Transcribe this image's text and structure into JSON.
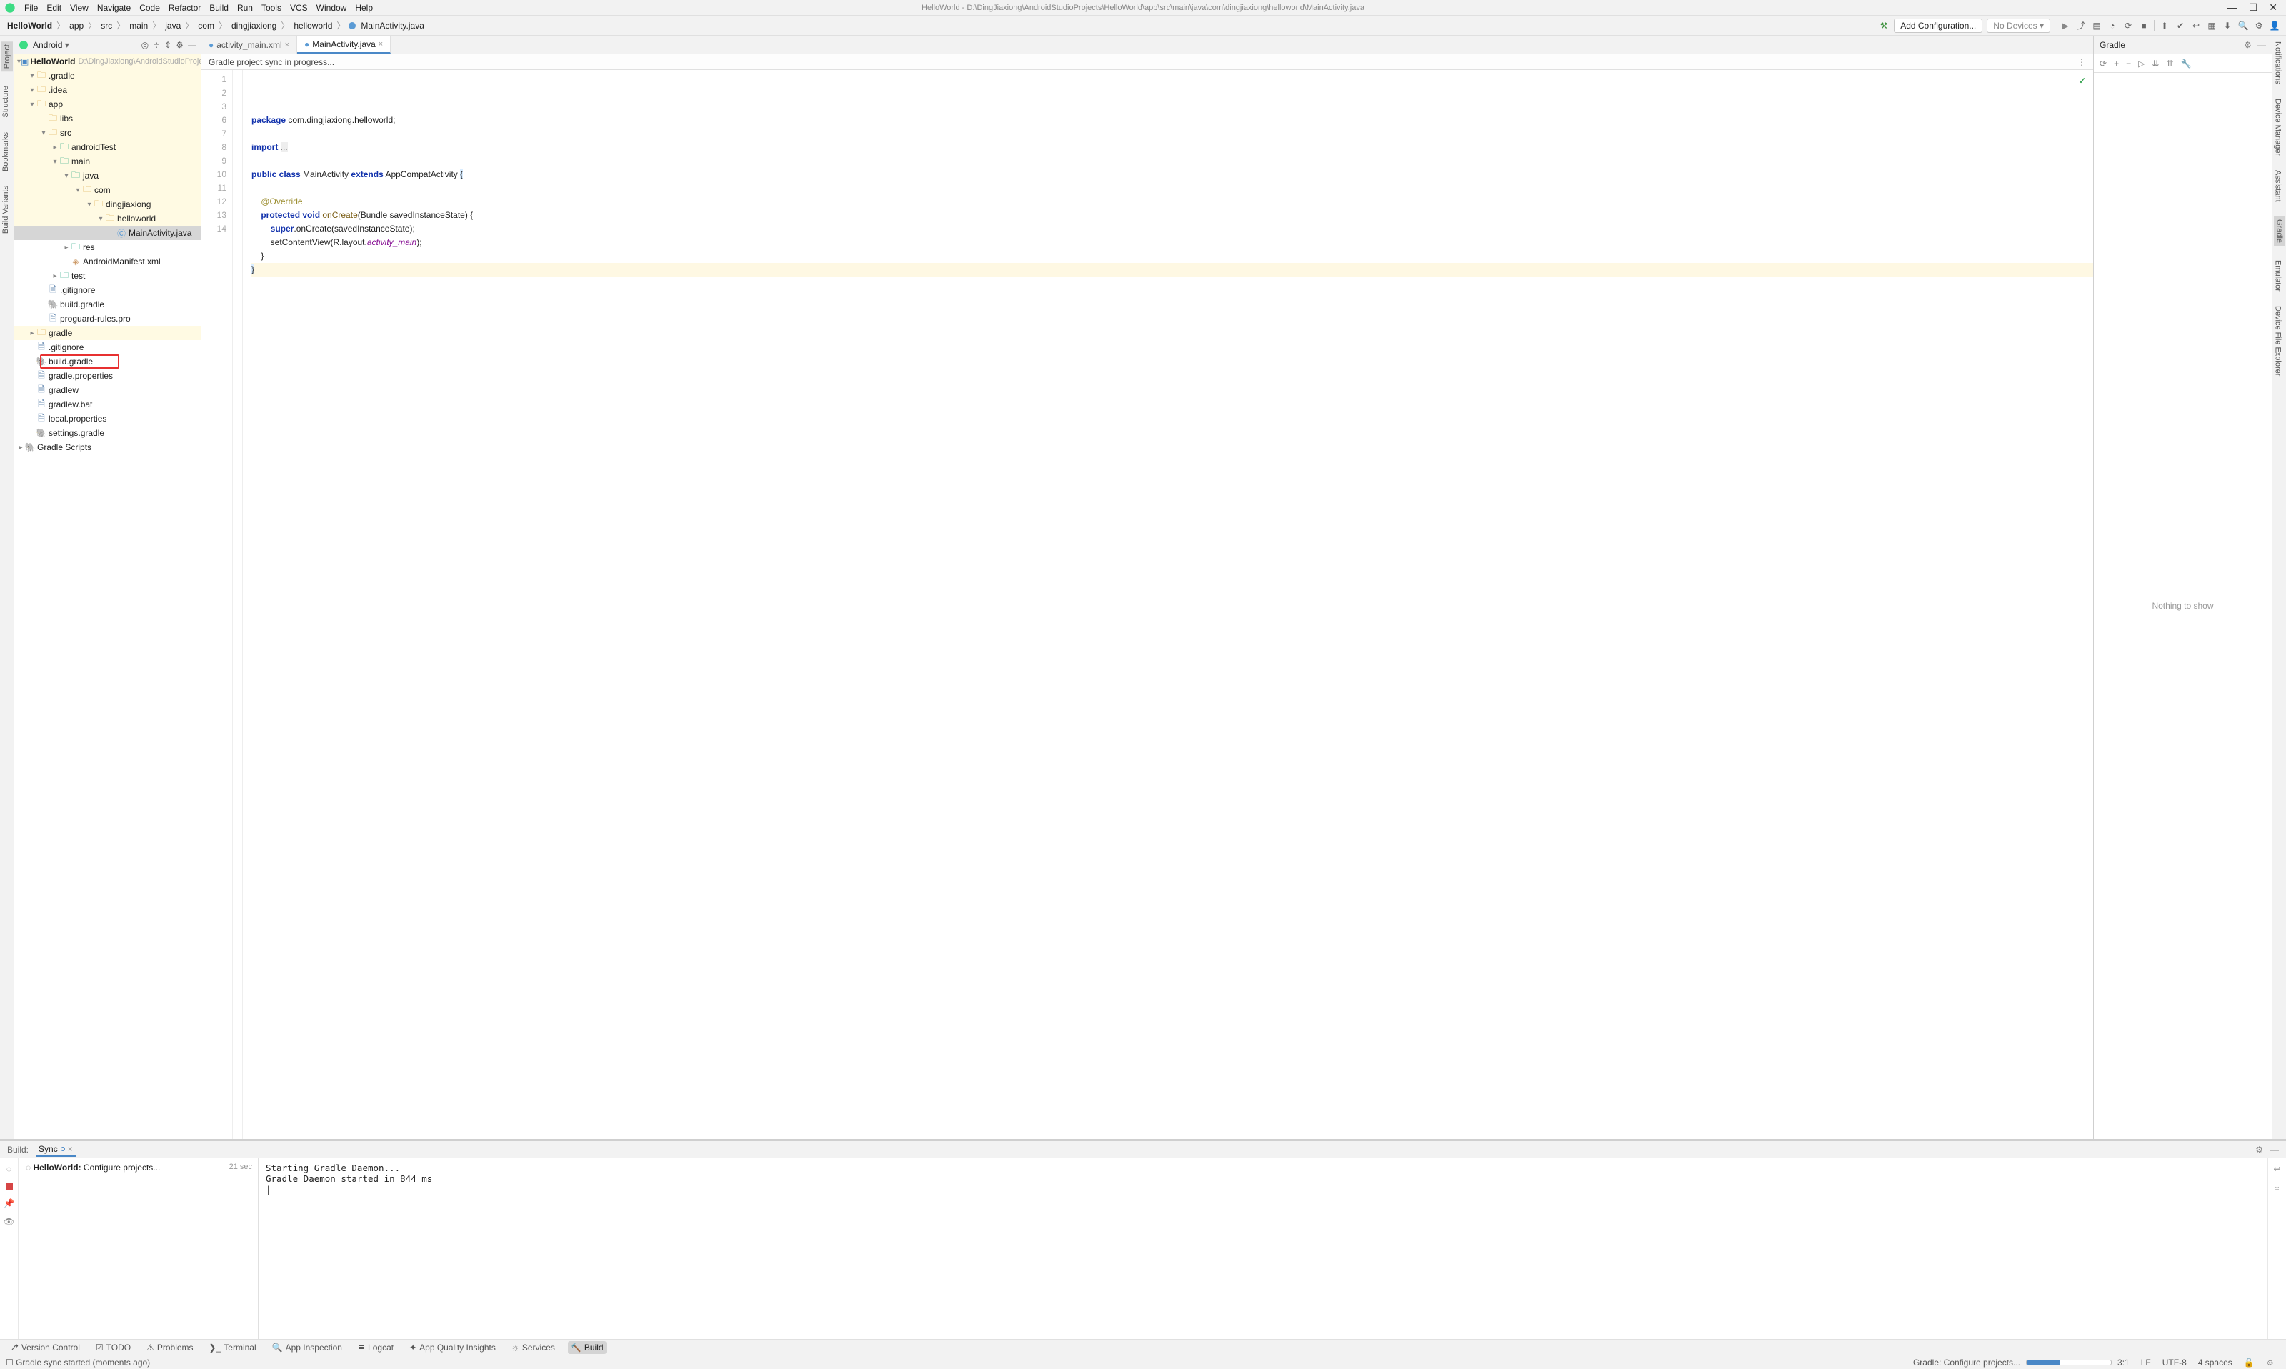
{
  "window_title": "HelloWorld - D:\\DingJiaxiong\\AndroidStudioProjects\\HelloWorld\\app\\src\\main\\java\\com\\dingjiaxiong\\helloworld\\MainActivity.java",
  "menu": [
    "File",
    "Edit",
    "View",
    "Navigate",
    "Code",
    "Refactor",
    "Build",
    "Run",
    "Tools",
    "VCS",
    "Window",
    "Help"
  ],
  "breadcrumbs": [
    "HelloWorld",
    "app",
    "src",
    "main",
    "java",
    "com",
    "dingjiaxiong",
    "helloworld",
    "MainActivity.java"
  ],
  "run_config_label": "Add Configuration...",
  "devices_label": "No Devices ▾",
  "project_panel": {
    "title": "Android",
    "dropdown": "▾"
  },
  "tree": {
    "root": "HelloWorld",
    "root_path": "D:\\DingJiaxiong\\AndroidStudioProjects",
    "nodes": [
      {
        "d": 1,
        "a": "▾",
        "t": "folder",
        "l": ".gradle",
        "hl": true
      },
      {
        "d": 1,
        "a": "▾",
        "t": "folder",
        "l": ".idea",
        "hl": true
      },
      {
        "d": 1,
        "a": "▾",
        "t": "folder",
        "l": "app",
        "hl": true,
        "open": true
      },
      {
        "d": 2,
        "a": "",
        "t": "folder",
        "l": "libs",
        "hl": true
      },
      {
        "d": 2,
        "a": "▾",
        "t": "folder",
        "l": "src",
        "hl": true,
        "open": true
      },
      {
        "d": 3,
        "a": "▸",
        "t": "folder-t",
        "l": "androidTest",
        "hl": true
      },
      {
        "d": 3,
        "a": "▾",
        "t": "folder-t",
        "l": "main",
        "hl": true,
        "open": true
      },
      {
        "d": 4,
        "a": "▾",
        "t": "folder-t",
        "l": "java",
        "hl": true,
        "open": true
      },
      {
        "d": 5,
        "a": "▾",
        "t": "folder",
        "l": "com",
        "hl": true,
        "open": true
      },
      {
        "d": 6,
        "a": "▾",
        "t": "folder",
        "l": "dingjiaxiong",
        "hl": true,
        "open": true
      },
      {
        "d": 7,
        "a": "▾",
        "t": "folder",
        "l": "helloworld",
        "hl": true,
        "open": true
      },
      {
        "d": 8,
        "a": "",
        "t": "class",
        "l": "MainActivity.java",
        "hl": true,
        "sel": true
      },
      {
        "d": 4,
        "a": "▸",
        "t": "folder-t",
        "l": "res",
        "hl": false
      },
      {
        "d": 4,
        "a": "",
        "t": "xml",
        "l": "AndroidManifest.xml",
        "hl": false
      },
      {
        "d": 3,
        "a": "▸",
        "t": "folder-t",
        "l": "test",
        "hl": false
      },
      {
        "d": 2,
        "a": "",
        "t": "file",
        "l": ".gitignore",
        "hl": false
      },
      {
        "d": 2,
        "a": "",
        "t": "gradle",
        "l": "build.gradle",
        "hl": false
      },
      {
        "d": 2,
        "a": "",
        "t": "file",
        "l": "proguard-rules.pro",
        "hl": false
      },
      {
        "d": 1,
        "a": "▸",
        "t": "folder",
        "l": "gradle",
        "hl": true
      },
      {
        "d": 1,
        "a": "",
        "t": "file",
        "l": ".gitignore",
        "hl": false
      },
      {
        "d": 1,
        "a": "",
        "t": "gradle",
        "l": "build.gradle",
        "hl": false,
        "red": true
      },
      {
        "d": 1,
        "a": "",
        "t": "file",
        "l": "gradle.properties",
        "hl": false
      },
      {
        "d": 1,
        "a": "",
        "t": "file",
        "l": "gradlew",
        "hl": false
      },
      {
        "d": 1,
        "a": "",
        "t": "file",
        "l": "gradlew.bat",
        "hl": false
      },
      {
        "d": 1,
        "a": "",
        "t": "file",
        "l": "local.properties",
        "hl": false
      },
      {
        "d": 1,
        "a": "",
        "t": "gradle",
        "l": "settings.gradle",
        "hl": false
      }
    ],
    "scripts_node": "Gradle Scripts"
  },
  "editor_tabs": [
    {
      "label": "activity_main.xml",
      "active": false
    },
    {
      "label": "MainActivity.java",
      "active": true
    }
  ],
  "sync_banner": "Gradle project sync in progress...",
  "code_lines": [
    {
      "n": 1,
      "html": "<span class='kw'>package</span> <span class='pkg'>com.dingjiaxiong.helloworld;</span>"
    },
    {
      "n": 2,
      "html": ""
    },
    {
      "n": 3,
      "html": "<span class='kw'>import</span> <span style='background:#eee;color:#888'>...</span>"
    },
    {
      "n": 6,
      "html": ""
    },
    {
      "n": 7,
      "html": "<span class='kw'>public class</span> <span class='cls'>MainActivity</span> <span class='kw'>extends</span> <span class='cls'>AppCompatActivity</span> <span class='paren-hl'>{</span>"
    },
    {
      "n": 8,
      "html": ""
    },
    {
      "n": 9,
      "html": "    <span class='ann'>@Override</span>"
    },
    {
      "n": 10,
      "html": "    <span class='kw'>protected void</span> <span class='mtd'>onCreate</span>(Bundle savedInstanceState) {"
    },
    {
      "n": 11,
      "html": "        <span class='kw'>super</span>.onCreate(savedInstanceState);"
    },
    {
      "n": 12,
      "html": "        setContentView(R.layout.<span style='color:#871094;font-style:italic'>activity_main</span>);"
    },
    {
      "n": 13,
      "html": "    }"
    },
    {
      "n": 14,
      "html": "<span class='caret-line'><span class='paren-hl'>}</span></span>"
    }
  ],
  "gradle_panel": {
    "title": "Gradle",
    "empty": "Nothing to show"
  },
  "build": {
    "header_label": "Build:",
    "tab": "Sync",
    "left_title": "HelloWorld:",
    "left_status": "Configure projects...",
    "left_time": "21 sec",
    "output_lines": [
      "Starting Gradle Daemon...",
      "Gradle Daemon started in 844 ms"
    ]
  },
  "bottom_tools": [
    "Version Control",
    "TODO",
    "Problems",
    "Terminal",
    "App Inspection",
    "Logcat",
    "App Quality Insights",
    "Services",
    "Build"
  ],
  "left_gutter": [
    "Project",
    "Structure",
    "Bookmarks",
    "Build Variants"
  ],
  "right_gutter": [
    "Notifications",
    "Device Manager",
    "Assistant",
    "Gradle",
    "Emulator",
    "Device File Explorer"
  ],
  "statusbar": {
    "left": "Gradle sync started (moments ago)",
    "right_task": "Gradle: Configure projects...",
    "caret": "3:1",
    "line_sep": "LF",
    "encoding": "UTF-8",
    "indent": "4 spaces"
  }
}
